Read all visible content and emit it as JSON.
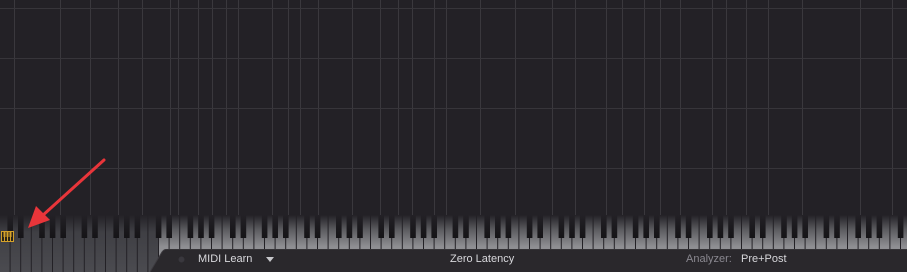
{
  "bottom_bar": {
    "midi_learn_label": "MIDI Learn",
    "latency_label": "Zero Latency",
    "analyzer_label": "Analyzer:",
    "analyzer_value": "Pre+Post"
  },
  "icons": {
    "piano_toggle": "piano-keys-icon",
    "midi_learn_indicator": "record-dot-icon",
    "midi_learn_menu": "triangle-down-icon"
  },
  "colors": {
    "background": "#232126",
    "grid_line": "#3a383d",
    "white_key": "#5a5a5e",
    "black_key": "#1b1a1d",
    "bar_background": "#2a282c",
    "text": "#d8d8dc",
    "label_muted": "#8a8890",
    "piano_icon": "#d4a12a",
    "arrow": "#e8353a"
  }
}
